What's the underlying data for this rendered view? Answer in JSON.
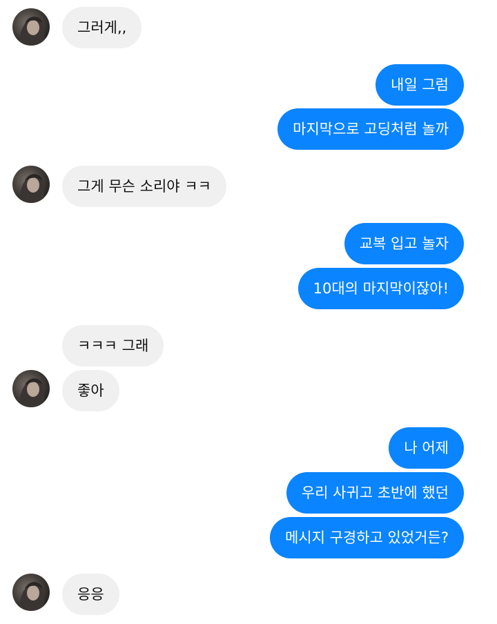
{
  "colors": {
    "incoming_bubble": "#f0f0f0",
    "outgoing_bubble": "#0a84ff",
    "incoming_text": "#111111",
    "outgoing_text": "#ffffff"
  },
  "avatar": {
    "icon": "contact-avatar"
  },
  "messages": [
    {
      "side": "in",
      "text": "그러게,,"
    },
    {
      "side": "out",
      "text": "내일 그럼"
    },
    {
      "side": "out",
      "text": "마지막으로 고딩처럼 놀까"
    },
    {
      "side": "in",
      "text": "그게 무슨 소리야 ㅋㅋ"
    },
    {
      "side": "out",
      "text": "교복 입고 놀자"
    },
    {
      "side": "out",
      "text": "10대의 마지막이잖아!"
    },
    {
      "side": "in",
      "text": "ㅋㅋㅋ 그래"
    },
    {
      "side": "in",
      "text": "좋아"
    },
    {
      "side": "out",
      "text": "나 어제"
    },
    {
      "side": "out",
      "text": "우리 사귀고 초반에 했던"
    },
    {
      "side": "out",
      "text": "메시지 구경하고 있었거든?"
    },
    {
      "side": "in",
      "text": "응응"
    }
  ]
}
